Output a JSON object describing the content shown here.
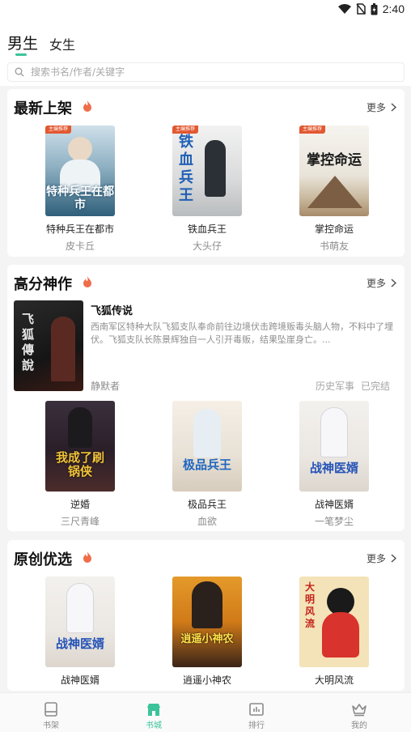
{
  "status_bar": {
    "time": "2:40"
  },
  "tabs": {
    "male": "男生",
    "female": "女生"
  },
  "search": {
    "placeholder": "搜索书名/作者/关键字"
  },
  "sections": {
    "latest": {
      "title": "最新上架",
      "more": "更多",
      "books": [
        {
          "title": "特种兵王在都市",
          "author": "皮卡丘",
          "badge": "主编推荐",
          "cover_text": "特种兵王在都市"
        },
        {
          "title": "铁血兵王",
          "author": "大头仔",
          "badge": "主编推荐",
          "cover_text": "铁血兵王"
        },
        {
          "title": "掌控命运",
          "author": "书萌友",
          "badge": "主编推荐",
          "cover_text": "掌控命运"
        }
      ]
    },
    "top_rated": {
      "title": "高分神作",
      "more": "更多",
      "featured": {
        "title": "飞狐传说",
        "description": "西南军区特种大队飞狐支队奉命前往边境伏击跨境贩毒头脑人物，不料中了埋伏。飞狐支队长陈景辉独自一人引开毒贩，结果坠崖身亡。...",
        "author": "静默者",
        "tags": [
          "历史军事",
          "已完结"
        ],
        "cover_text": "飞狐傳說"
      },
      "books": [
        {
          "title": "逆婚",
          "author": "三尺青峰",
          "cover_text": "我成了刷锅侠"
        },
        {
          "title": "极品兵王",
          "author": "血欲",
          "cover_text": "极品兵王"
        },
        {
          "title": "战神医婿",
          "author": "一笔梦尘",
          "cover_text": "战神医婿"
        }
      ]
    },
    "original": {
      "title": "原创优选",
      "more": "更多",
      "books": [
        {
          "title": "战神医婿",
          "cover_text": "战神医婿"
        },
        {
          "title": "逍遥小神农",
          "cover_text": "逍遥小神农"
        },
        {
          "title": "大明风流",
          "cover_text": "大明风流"
        }
      ]
    }
  },
  "bottom_nav": [
    {
      "label": "书架",
      "icon": "book-icon",
      "active": false
    },
    {
      "label": "书城",
      "icon": "store-icon",
      "active": true
    },
    {
      "label": "排行",
      "icon": "chart-icon",
      "active": false
    },
    {
      "label": "我的",
      "icon": "crown-icon",
      "active": false
    }
  ],
  "colors": {
    "accent": "#3cc39a",
    "fire": "#ef6d4a",
    "badge": "#e25830"
  }
}
